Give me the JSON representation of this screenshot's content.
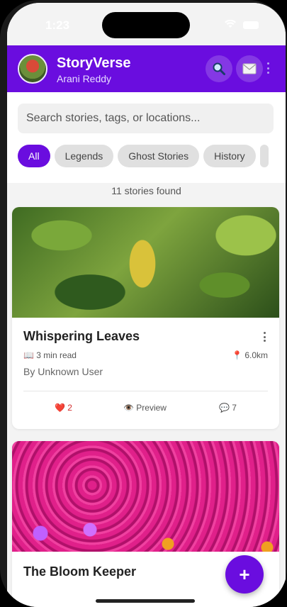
{
  "status": {
    "time": "1:23"
  },
  "header": {
    "title": "StoryVerse",
    "subtitle": "Arani Reddy"
  },
  "search": {
    "placeholder": "Search stories, tags, or locations..."
  },
  "filters": [
    "All",
    "Legends",
    "Ghost Stories",
    "History"
  ],
  "results": {
    "count_text": "11 stories found"
  },
  "stories": [
    {
      "title": "Whispering Leaves",
      "read_time": "📖 3 min read",
      "distance": "📍 6.0km",
      "author": "By Unknown User",
      "likes": "❤️ 2",
      "preview": "👁️ Preview",
      "comments": "💬 7"
    },
    {
      "title": "The Bloom Keeper"
    }
  ],
  "fab": {
    "label": "+"
  },
  "colors": {
    "primary": "#6a0ddf",
    "background": "#f3f3f3"
  },
  "icons": [
    "search-icon",
    "mail-icon",
    "more-vert-icon",
    "plus-icon"
  ]
}
